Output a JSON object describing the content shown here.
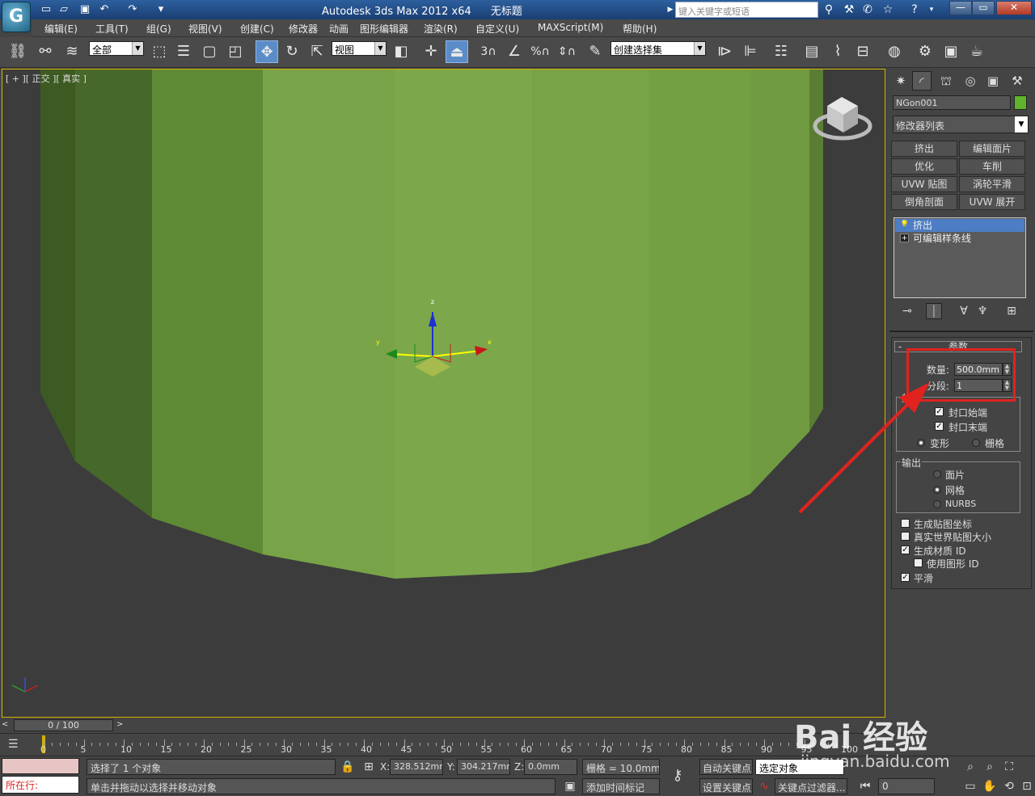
{
  "titlebar": {
    "app_title": "Autodesk 3ds Max  2012 x64",
    "doc_title": "无标题",
    "search_placeholder": "键入关键字或短语"
  },
  "menu": [
    "编辑(E)",
    "工具(T)",
    "组(G)",
    "视图(V)",
    "创建(C)",
    "修改器",
    "动画",
    "图形编辑器",
    "渲染(R)",
    "自定义(U)",
    "MAXScript(M)",
    "帮助(H)"
  ],
  "toolbar": {
    "filter_select": "全部",
    "coord_select": "视图",
    "selection_set": "创建选择集"
  },
  "viewport": {
    "label": "[ + ][ 正交 ][ 真实 ]",
    "object_color": "#7aa349",
    "frame_color": "#d4b100"
  },
  "panel": {
    "object_name": "NGon001",
    "object_color": "#5fb32b",
    "modifier_list": "修改器列表",
    "modifier_buttons": [
      "挤出",
      "编辑面片",
      "优化",
      "车削",
      "UVW 贴图",
      "涡轮平滑",
      "倒角剖面",
      "UVW 展开"
    ],
    "stack": [
      "挤出",
      "可编辑样条线"
    ],
    "params_title": "参数",
    "amount_label": "数量:",
    "amount_value": "500.0mm",
    "segments_label": "分段:",
    "segments_value": "1",
    "capping_group": "封口",
    "cap_start": "封口始端",
    "cap_end": "封口末端",
    "morph": "变形",
    "grid": "栅格",
    "output_group": "输出",
    "out_patch": "面片",
    "out_mesh": "网格",
    "out_nurbs": "NURBS",
    "gen_map_coords": "生成贴图坐标",
    "real_world_map": "真实世界贴图大小",
    "gen_mat_ids": "生成材质 ID",
    "use_shape_ids": "使用图形 ID",
    "smooth": "平滑"
  },
  "timeline": {
    "slider": "0 / 100",
    "ticks": [
      "0",
      "5",
      "10",
      "15",
      "20",
      "25",
      "30",
      "35",
      "40",
      "45",
      "50",
      "55",
      "60",
      "65",
      "70",
      "75",
      "80",
      "85",
      "90",
      "95",
      "100"
    ]
  },
  "status": {
    "selected": "选择了 1 个对象",
    "prompt": "单击并拖动以选择并移动对象",
    "running": "所在行:",
    "x_label": "X:",
    "x_value": "328.512mr",
    "y_label": "Y:",
    "y_value": "304.217mr",
    "z_label": "Z:",
    "z_value": "0.0mm",
    "grid": "栅格 = 10.0mm",
    "add_time_tag": "添加时间标记",
    "auto_key": "自动关键点",
    "set_key": "设置关键点",
    "key_mode": "选定对象",
    "key_filters": "关键点过滤器...",
    "frame": "0"
  },
  "watermark": {
    "brand": "Bai 经验",
    "url": "jingyan.baidu.com"
  }
}
